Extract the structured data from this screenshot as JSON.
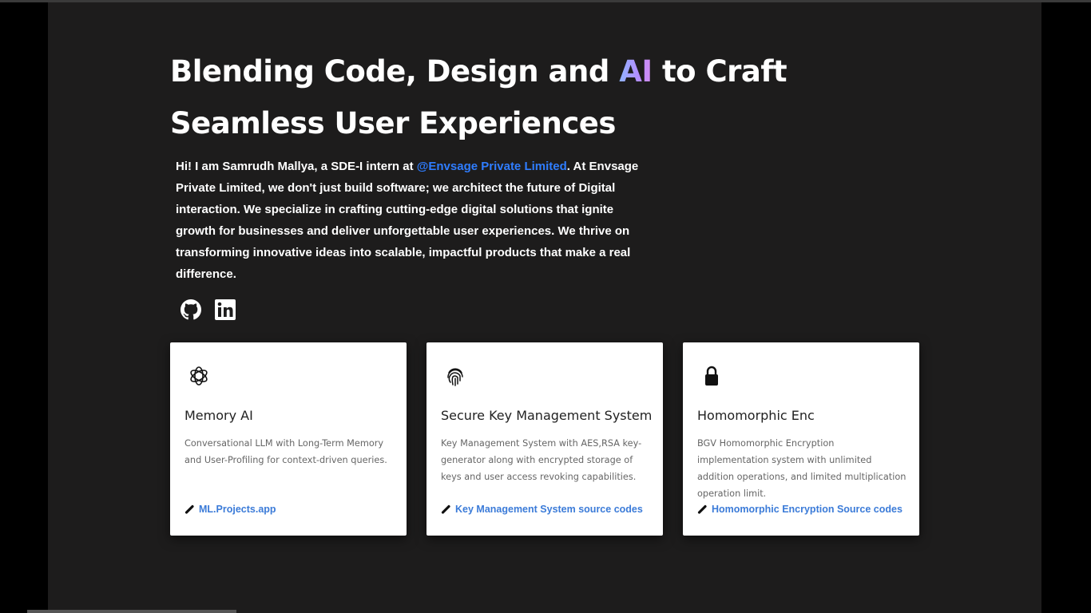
{
  "hero": {
    "title_part1": "Blending Code, Design and ",
    "title_ai": "AI",
    "title_part2": " to Craft",
    "title_line2": "Seamless User Experiences"
  },
  "intro": {
    "prefix": "Hi! I am Samrudh Mallya, a SDE-I intern at ",
    "company_link": "@Envsage Private Limited",
    "suffix": ". At Envsage Private Limited, we don't just build software; we architect the future of Digital interaction. We specialize in crafting cutting-edge digital solutions that ignite growth for businesses and deliver unforgettable user experiences. We thrive on transforming innovative ideas into scalable, impactful products that make a real difference."
  },
  "socials": [
    {
      "icon": "github-icon"
    },
    {
      "icon": "linkedin-icon"
    }
  ],
  "projects": [
    {
      "icon": "openai-icon",
      "title": "Memory AI",
      "description": "Conversational LLM with Long-Term Memory and User-Profiling for context-driven queries.",
      "link": "ML.Projects.app"
    },
    {
      "icon": "fingerprint-icon",
      "title": "Secure Key Management System",
      "description": "Key Management System with AES,RSA key-generator along with encrypted storage of keys and user access revoking capabilities.",
      "link": "Key Management System source codes"
    },
    {
      "icon": "lock-icon",
      "title": "Homomorphic Enc",
      "description": "BGV Homomorphic Encryption implementation system with unlimited addition operations, and limited multiplication operation limit.",
      "link": "Homomorphic Encryption Source codes"
    }
  ],
  "colors": {
    "background": "#1d1c1c",
    "link_blue": "#2f7dff",
    "card_link_blue": "#3b7bd8",
    "ai_gradient": [
      "#8fb4ff",
      "#b48cff",
      "#d68cf0"
    ]
  }
}
